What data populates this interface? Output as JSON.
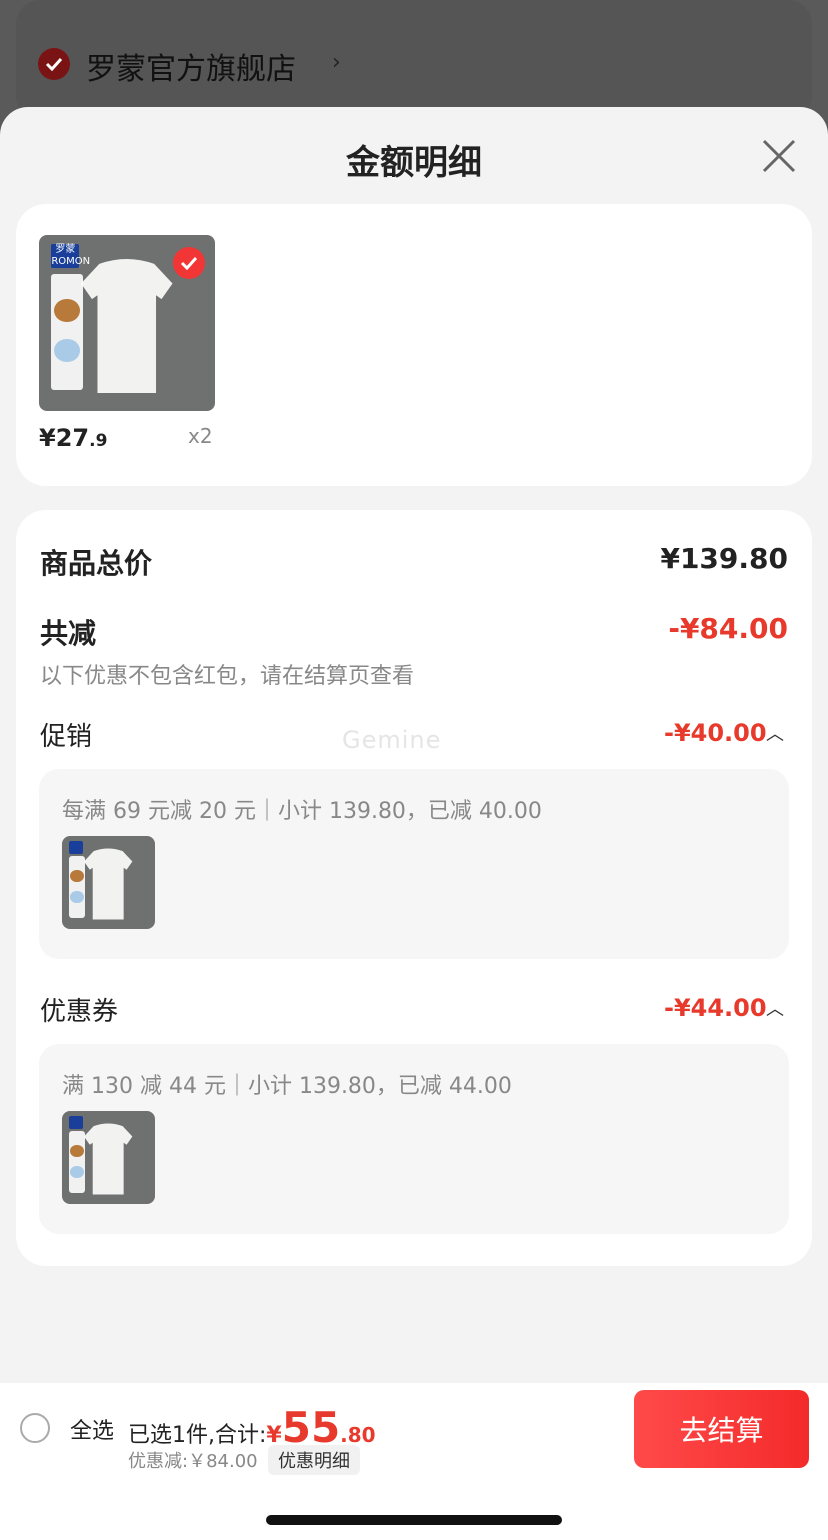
{
  "background": {
    "store_name": "罗蒙官方旗舰店",
    "chevron": "›"
  },
  "sheet": {
    "title": "金额明细",
    "close_icon": "close-icon"
  },
  "product": {
    "brand_text": "罗蒙 ROMON",
    "price_int": "¥27",
    "price_dec": ".9",
    "qty": "x2",
    "selected": true
  },
  "detail": {
    "total_label": "商品总价",
    "total_value": "¥139.80",
    "reduce_label": "共减",
    "reduce_value": "-¥84.00",
    "note": "以下优惠不包含红包，请在结算页查看",
    "watermark": "Gemine",
    "promo": {
      "label": "促销",
      "value": "-¥40.00",
      "desc": "每满 69 元减 20 元｜小计 139.80，已减 40.00"
    },
    "coupon": {
      "label": "优惠券",
      "value": "-¥44.00",
      "desc": "满 130 减 44 元｜小计 139.80，已减 44.00"
    }
  },
  "bottom": {
    "select_all": "全选",
    "summary_label": "已选1件,合计:",
    "currency": "¥",
    "total_int": "55",
    "total_dec": ".80",
    "discount": "优惠减:￥84.00",
    "detail_link": "优惠明细",
    "checkout": "去结算"
  },
  "colors": {
    "accent_red": "#e83a2c",
    "button_red": "#f42a2a"
  }
}
